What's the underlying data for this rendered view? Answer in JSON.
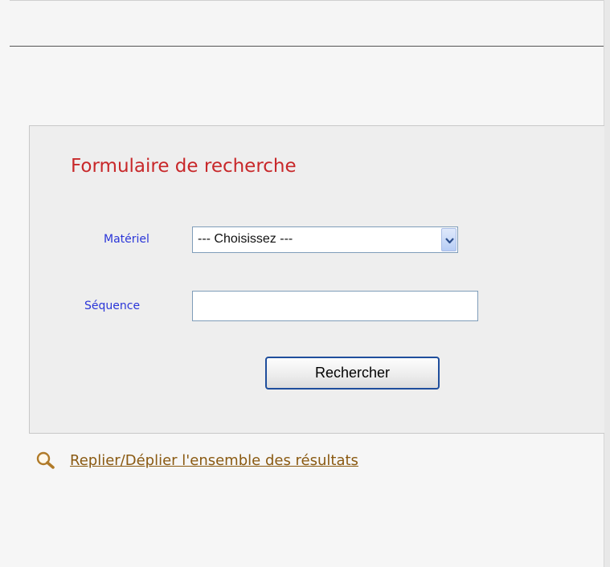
{
  "search_form": {
    "title": "Formulaire de recherche",
    "materiel_label": "Matériel",
    "materiel_selected": "--- Choisissez ---",
    "sequence_label": "Séquence",
    "sequence_value": "",
    "submit_label": "Rechercher"
  },
  "results": {
    "toggle_label": "Replier/Déplier l'ensemble des résultats"
  },
  "colors": {
    "title": "#c8282a",
    "labels": "#2a35d8",
    "link": "#8a5a12",
    "button_border": "#1f4e9c",
    "panel_background": "#eeeeee"
  },
  "icons": {
    "dropdown": "chevron-down-icon",
    "toggle": "magnifier-icon"
  }
}
